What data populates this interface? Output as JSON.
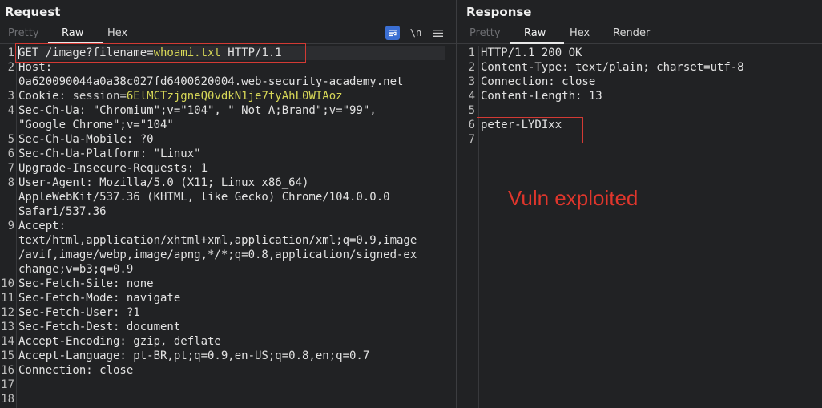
{
  "request": {
    "title": "Request",
    "tabs": [
      "Pretty",
      "Raw",
      "Hex"
    ],
    "active_tab": "Raw",
    "toolbar": {
      "pretty_icon": "wrap-lines-icon",
      "newline_label": "\\n",
      "menu_icon": "hamburger-menu-icon"
    },
    "lines": [
      {
        "n": "1",
        "parts": [
          {
            "t": "GET /image?filename="
          },
          {
            "t": "whoami.txt",
            "c": "hl"
          },
          {
            "t": " HTTP/1.1"
          }
        ]
      },
      {
        "n": "2",
        "parts": [
          {
            "t": "Host:"
          }
        ]
      },
      {
        "n": "",
        "parts": [
          {
            "t": "0a620090044a0a38c027fd6400620004.web-security-academy.net"
          }
        ]
      },
      {
        "n": "3",
        "parts": [
          {
            "t": "Cookie: "
          },
          {
            "t": "session=",
            "c": "val"
          },
          {
            "t": "6ElMCTzjgneQ0vdkN1je7tyAhL0WIAoz",
            "c": "hl"
          }
        ]
      },
      {
        "n": "4",
        "parts": [
          {
            "t": "Sec-Ch-Ua: \"Chromium\";v=\"104\", \" Not A;Brand\";v=\"99\","
          }
        ]
      },
      {
        "n": "",
        "parts": [
          {
            "t": "\"Google Chrome\";v=\"104\""
          }
        ]
      },
      {
        "n": "5",
        "parts": [
          {
            "t": "Sec-Ch-Ua-Mobile: ?0"
          }
        ]
      },
      {
        "n": "6",
        "parts": [
          {
            "t": "Sec-Ch-Ua-Platform: \"Linux\""
          }
        ]
      },
      {
        "n": "7",
        "parts": [
          {
            "t": "Upgrade-Insecure-Requests: 1"
          }
        ]
      },
      {
        "n": "8",
        "parts": [
          {
            "t": "User-Agent: Mozilla/5.0 (X11; Linux x86_64)"
          }
        ]
      },
      {
        "n": "",
        "parts": [
          {
            "t": "AppleWebKit/537.36 (KHTML, like Gecko) Chrome/104.0.0.0"
          }
        ]
      },
      {
        "n": "",
        "parts": [
          {
            "t": "Safari/537.36"
          }
        ]
      },
      {
        "n": "9",
        "parts": [
          {
            "t": "Accept:"
          }
        ]
      },
      {
        "n": "",
        "parts": [
          {
            "t": "text/html,application/xhtml+xml,application/xml;q=0.9,image"
          }
        ]
      },
      {
        "n": "",
        "parts": [
          {
            "t": "/avif,image/webp,image/apng,*/*;q=0.8,application/signed-ex"
          }
        ]
      },
      {
        "n": "",
        "parts": [
          {
            "t": "change;v=b3;q=0.9"
          }
        ]
      },
      {
        "n": "10",
        "parts": [
          {
            "t": "Sec-Fetch-Site: none"
          }
        ]
      },
      {
        "n": "11",
        "parts": [
          {
            "t": "Sec-Fetch-Mode: navigate"
          }
        ]
      },
      {
        "n": "12",
        "parts": [
          {
            "t": "Sec-Fetch-User: ?1"
          }
        ]
      },
      {
        "n": "13",
        "parts": [
          {
            "t": "Sec-Fetch-Dest: document"
          }
        ]
      },
      {
        "n": "14",
        "parts": [
          {
            "t": "Accept-Encoding: gzip, deflate"
          }
        ]
      },
      {
        "n": "15",
        "parts": [
          {
            "t": "Accept-Language: pt-BR,pt;q=0.9,en-US;q=0.8,en;q=0.7"
          }
        ]
      },
      {
        "n": "16",
        "parts": [
          {
            "t": "Connection: close"
          }
        ]
      },
      {
        "n": "17",
        "parts": [
          {
            "t": ""
          }
        ]
      },
      {
        "n": "18",
        "parts": [
          {
            "t": ""
          }
        ]
      }
    ]
  },
  "response": {
    "title": "Response",
    "tabs": [
      "Pretty",
      "Raw",
      "Hex",
      "Render"
    ],
    "active_tab": "Raw",
    "lines": [
      {
        "n": "1",
        "parts": [
          {
            "t": "HTTP/1.1 200 OK"
          }
        ]
      },
      {
        "n": "2",
        "parts": [
          {
            "t": "Content-Type: text/plain; charset=utf-8"
          }
        ]
      },
      {
        "n": "3",
        "parts": [
          {
            "t": "Connection: close"
          }
        ]
      },
      {
        "n": "4",
        "parts": [
          {
            "t": "Content-Length: 13"
          }
        ]
      },
      {
        "n": "5",
        "parts": [
          {
            "t": ""
          }
        ]
      },
      {
        "n": "6",
        "parts": [
          {
            "t": "peter-LYDIxx"
          }
        ]
      },
      {
        "n": "7",
        "parts": [
          {
            "t": ""
          }
        ]
      }
    ],
    "annotation": "Vuln exploited"
  },
  "colors": {
    "background": "#212224",
    "highlight_yellow": "#d7d757",
    "annotation_red": "#e0362c",
    "accent_blue": "#3b6fd3"
  }
}
